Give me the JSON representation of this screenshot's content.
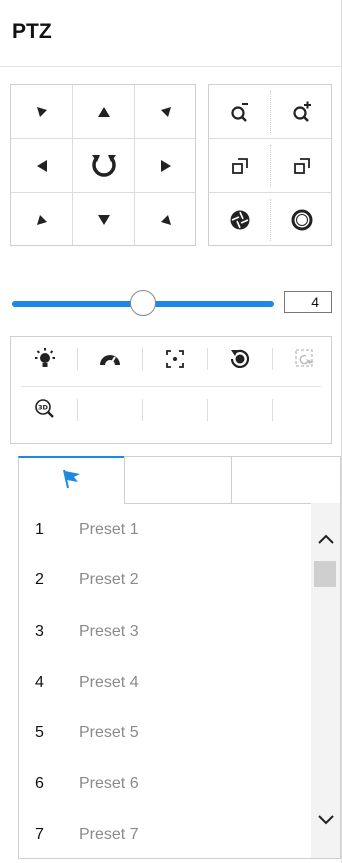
{
  "panel": {
    "title": "PTZ"
  },
  "speed": {
    "value": "4",
    "level_fraction": 0.5
  },
  "direction_buttons": [
    {
      "name": "pan-up-left-button",
      "icon": "arrow-up-left-icon"
    },
    {
      "name": "pan-up-button",
      "icon": "arrow-up-icon"
    },
    {
      "name": "pan-up-right-button",
      "icon": "arrow-up-right-icon"
    },
    {
      "name": "pan-left-button",
      "icon": "arrow-left-icon"
    },
    {
      "name": "auto-pan-button",
      "icon": "rotate-icon"
    },
    {
      "name": "pan-right-button",
      "icon": "arrow-right-icon"
    },
    {
      "name": "pan-down-left-button",
      "icon": "arrow-down-left-icon"
    },
    {
      "name": "pan-down-button",
      "icon": "arrow-down-icon"
    },
    {
      "name": "pan-down-right-button",
      "icon": "arrow-down-right-icon"
    }
  ],
  "lens_buttons": [
    {
      "name": "zoom-out-button",
      "icon": "zoom-out-icon"
    },
    {
      "name": "zoom-in-button",
      "icon": "zoom-in-icon"
    },
    {
      "name": "focus-near-button",
      "icon": "focus-near-icon"
    },
    {
      "name": "focus-far-button",
      "icon": "focus-far-icon"
    },
    {
      "name": "iris-close-button",
      "icon": "iris-close-icon"
    },
    {
      "name": "iris-open-button",
      "icon": "iris-open-icon"
    }
  ],
  "function_buttons": [
    {
      "name": "light-button",
      "icon": "light-icon"
    },
    {
      "name": "wiper-button",
      "icon": "wiper-icon"
    },
    {
      "name": "one-touch-focus-button",
      "icon": "focus-frame-icon"
    },
    {
      "name": "lens-init-button",
      "icon": "lens-init-icon"
    },
    {
      "name": "manual-track-button",
      "icon": "track-icon"
    },
    {
      "name": "3d-zoom-button",
      "icon": "3d-zoom-icon"
    }
  ],
  "tabs": [
    {
      "name": "tab-preset",
      "icon": "flag-icon",
      "active": true
    },
    {
      "name": "tab-patrol",
      "icon": "",
      "active": false
    },
    {
      "name": "tab-pattern",
      "icon": "",
      "active": false
    }
  ],
  "presets": [
    {
      "num": "1",
      "name": "Preset 1"
    },
    {
      "num": "2",
      "name": "Preset 2"
    },
    {
      "num": "3",
      "name": "Preset 3"
    },
    {
      "num": "4",
      "name": "Preset 4"
    },
    {
      "num": "5",
      "name": "Preset 5"
    },
    {
      "num": "6",
      "name": "Preset 6"
    },
    {
      "num": "7",
      "name": "Preset 7"
    }
  ],
  "colors": {
    "accent": "#1e88e5",
    "icon": "#222222",
    "muted_text": "#8a8a8a"
  }
}
